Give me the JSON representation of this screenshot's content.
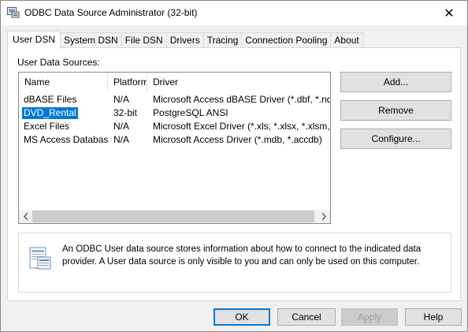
{
  "window": {
    "title": "ODBC Data Source Administrator (32-bit)",
    "close_glyph": "✕"
  },
  "tabs": [
    {
      "label": "User DSN",
      "active": true
    },
    {
      "label": "System DSN",
      "active": false
    },
    {
      "label": "File DSN",
      "active": false
    },
    {
      "label": "Drivers",
      "active": false
    },
    {
      "label": "Tracing",
      "active": false
    },
    {
      "label": "Connection Pooling",
      "active": false
    },
    {
      "label": "About",
      "active": false
    }
  ],
  "user_dsn": {
    "group_label": "User Data Sources:",
    "columns": [
      "Name",
      "Platform",
      "Driver"
    ],
    "rows": [
      {
        "name": "dBASE Files",
        "platform": "N/A",
        "driver": "Microsoft Access dBASE Driver (*.dbf, *.ndx, *.m"
      },
      {
        "name": "DVD_Rental",
        "platform": "32-bit",
        "driver": "PostgreSQL ANSI",
        "selected": true
      },
      {
        "name": "Excel Files",
        "platform": "N/A",
        "driver": "Microsoft Excel Driver (*.xls, *.xlsx, *.xlsm, *.xlsb)"
      },
      {
        "name": "MS Access Database",
        "platform": "N/A",
        "driver": "Microsoft Access Driver (*.mdb, *.accdb)"
      }
    ],
    "buttons": {
      "add": "Add...",
      "remove": "Remove",
      "configure": "Configure..."
    },
    "info_text": "An ODBC User data source stores information about how to connect to the indicated data provider.   A User data source is only visible to you and can only be used on this computer."
  },
  "footer_buttons": {
    "ok": "OK",
    "cancel": "Cancel",
    "apply": "Apply",
    "help": "Help"
  },
  "icons": {
    "app": "odbc-admin-icon",
    "info": "data-source-document-icon",
    "scroll_left": "chevron-left-icon",
    "scroll_right": "chevron-right-icon"
  },
  "colors": {
    "selection": "#0078d7",
    "window_bg": "#f0f0f0",
    "panel_bg": "#ffffff"
  }
}
